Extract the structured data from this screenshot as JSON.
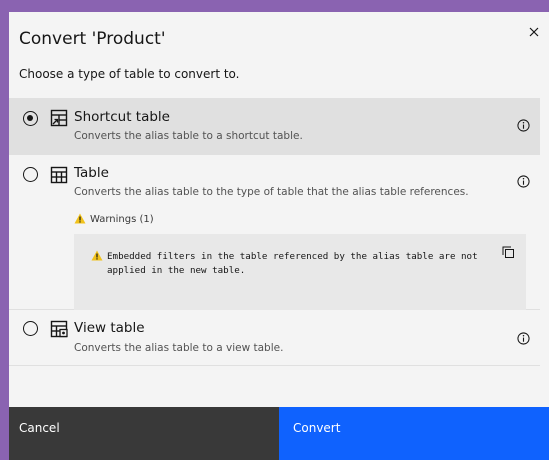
{
  "dialog": {
    "title": "Convert 'Product'",
    "close_icon": "close-icon",
    "subtitle": "Choose a type of table to convert to."
  },
  "options": [
    {
      "label": "Shortcut table",
      "description": "Converts the alias table to a shortcut table.",
      "selected": true,
      "icon": "shortcut-table-icon"
    },
    {
      "label": "Table",
      "description": "Converts the alias table to the type of table that the alias table references.",
      "selected": false,
      "icon": "table-icon",
      "warnings_label": "Warnings (1)",
      "warning_message": "Embedded filters in the table referenced by the alias table are not applied in the new table."
    },
    {
      "label": "View table",
      "description": "Converts the alias table to a view table.",
      "selected": false,
      "icon": "view-table-icon"
    }
  ],
  "footer": {
    "cancel_label": "Cancel",
    "convert_label": "Convert"
  },
  "colors": {
    "primary": "#0f62fe",
    "secondary": "#393939",
    "warning": "#f1c21b",
    "frame": "#8a63b1"
  }
}
